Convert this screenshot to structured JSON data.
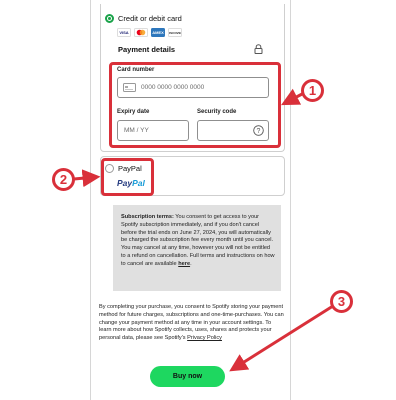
{
  "payment": {
    "card_option": {
      "label": "Credit or debit card",
      "selected": true
    },
    "brands": [
      "VISA",
      "Mastercard",
      "AMEX",
      "DISCOVER"
    ],
    "details_title": "Payment details",
    "card_number": {
      "label": "Card number",
      "placeholder": "0000 0000 0000 0000"
    },
    "expiry": {
      "label": "Expiry date",
      "placeholder": "MM / YY"
    },
    "security": {
      "label": "Security code"
    },
    "paypal_option": {
      "label": "PayPal",
      "selected": false
    },
    "paypal_logo": {
      "pay": "Pay",
      "pal": "Pal"
    }
  },
  "terms": {
    "heading": "Subscription terms:",
    "body": "You consent to get access to your Spotify subscription immediately, and if you don't cancel before the trial ends on June 27, 2024, you will automatically be charged the subscription fee every month until you cancel. You may cancel at any time, however you will not be entitled to a refund on cancellation. Full terms and instructions on how to cancel are available",
    "link": "here",
    "end": "."
  },
  "consent": {
    "body": "By completing your purchase, you consent to Spotify storing your payment method for future charges, subscriptions and one-time-purchases. You can change your payment method at any time in your account settings. To learn more about how Spotify collects, uses, shares and protects your personal data, please see Spotify's",
    "link": "Privacy Policy"
  },
  "buy_button": {
    "label": "Buy now"
  },
  "annotations": {
    "step1": "1",
    "step2": "2",
    "step3": "3",
    "color": "#d9303a"
  },
  "colors": {
    "accent_green": "#1ed760",
    "radio_green": "#1aa34a",
    "paypal_dark": "#253b80",
    "paypal_light": "#179bd7"
  }
}
